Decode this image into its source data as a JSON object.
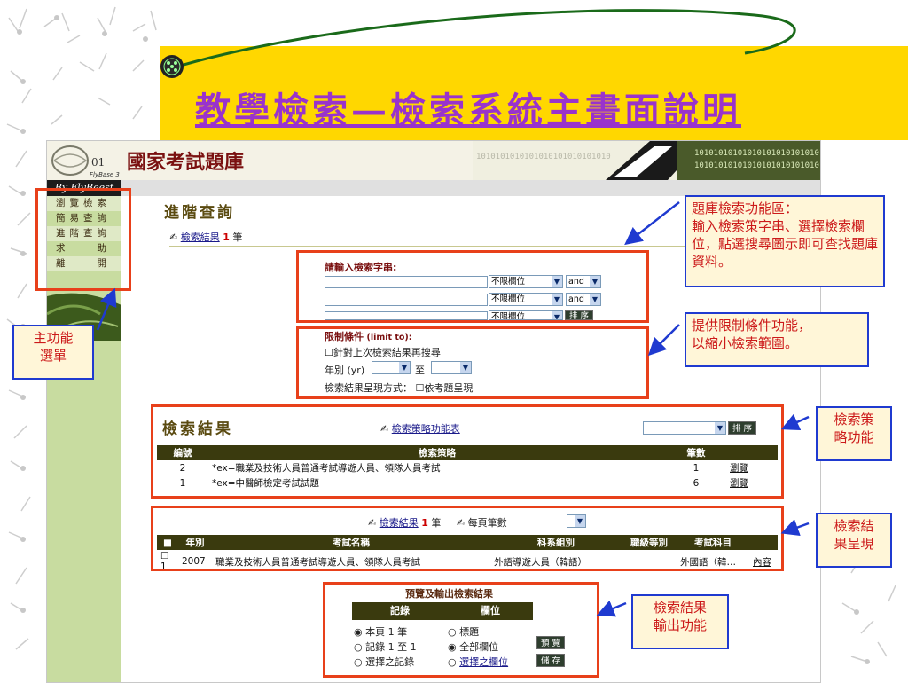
{
  "slide": {
    "title": "教學檢索—檢索系統主畫面說明"
  },
  "app": {
    "title": "國家考試題庫",
    "brand": "By FlyBeest",
    "logo_text": "FlyBase 3",
    "banner_digits": "1010101010101010101010101010",
    "menu": [
      "瀏覽檢索",
      "簡易查詢",
      "進階查詢",
      "求　　助",
      "離　　開"
    ]
  },
  "advanced": {
    "heading": "進階查詢",
    "result_link": "檢索結果",
    "result_count": "1",
    "result_unit": "筆",
    "input_label": "請輸入檢索字串:",
    "field_select": "不限欄位",
    "op_select": "and",
    "sort_button": "排 序",
    "limit_label": "限制條件",
    "limit_sub": "(limit to):",
    "limit_check": "針對上次檢索結果再搜尋",
    "year_label": "年別 (yr)",
    "year_to": "至",
    "display_label": "檢索結果呈現方式：",
    "display_check": "依考題呈現"
  },
  "strategy": {
    "heading": "檢索結果",
    "link": "檢索策略功能表",
    "sort_button": "排 序",
    "columns": [
      "編號",
      "檢索策略",
      "筆數",
      ""
    ],
    "rows": [
      {
        "no": "2",
        "query": "*ex=職業及技術人員普通考試導遊人員、領隊人員考試",
        "count": "1",
        "action": "瀏覽"
      },
      {
        "no": "1",
        "query": "*ex=中醫師檢定考試試題",
        "count": "6",
        "action": "瀏覽"
      }
    ]
  },
  "results": {
    "link": "檢索結果",
    "count": "1",
    "unit": "筆",
    "per_page": "每頁筆數",
    "columns": [
      "",
      "年別",
      "考試名稱",
      "科系組別",
      "職級等別",
      "考試科目",
      ""
    ],
    "rows": [
      {
        "no": "1",
        "year": "2007",
        "exam": "職業及技術人員普通考試導遊人員、領隊人員考試",
        "dept": "外語導遊人員（韓語）",
        "level": "",
        "subject": "外國語（韓…",
        "action": "內容"
      }
    ]
  },
  "output": {
    "title": "預覽及輸出檢索結果",
    "col1": "記錄",
    "col2": "欄位",
    "rec_options": [
      "本頁 1 筆",
      "記錄 1 至 1",
      "選擇之記錄"
    ],
    "field_options": [
      "標題",
      "全部欄位",
      "選擇之欄位"
    ],
    "preview_button": "預 覽",
    "save_button": "儲 存"
  },
  "callouts": {
    "search_area": "題庫檢索功能區：\n輸入檢索策字串、選擇檢索欄位，點選搜尋圖示即可查找題庫資料。",
    "limit": "提供限制條件功能，\n以縮小檢索範圍。",
    "menu": "主功能\n選單",
    "strategy": "檢索策\n略功能",
    "results": "檢索結\n果呈現",
    "output": "檢索結果\n輸出功能"
  },
  "colors": {
    "title_purple": "#9933cc",
    "highlight_red": "#e8401a",
    "callout_blue": "#1f3ad0",
    "callout_text": "#cc1a1a",
    "band_yellow": "#ffd700"
  }
}
